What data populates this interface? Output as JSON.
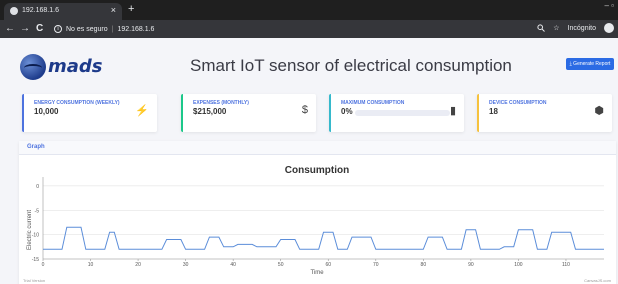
{
  "browser": {
    "tab_title": "192.168.1.6",
    "tab_close": "×",
    "new_tab": "+",
    "window_controls": "–  ▫",
    "nav_back": "←",
    "nav_forward": "→",
    "nav_reload": "C",
    "security_text": "No es seguro",
    "url": "192.168.1.6",
    "zoom_icon": "search-icon",
    "star_icon": "☆",
    "incognito_label": "Incógnito"
  },
  "header": {
    "logo_text": "mads",
    "title": "Smart IoT sensor of electrical consumption",
    "report_button": "⤓ Generate Report"
  },
  "cards": [
    {
      "label": "ENERGY CONSUMPTION (WEEKLY)",
      "value": "10,000",
      "icon": "⚡",
      "color": "#4e73df"
    },
    {
      "label": "EXPENSES (MONTHLY)",
      "value": "$215,000",
      "icon": "$",
      "color": "#1cc88a"
    },
    {
      "label": "MAXIMUM CONSUMPTION",
      "value": "0%",
      "icon": "▮",
      "color": "#36b9cc",
      "progress": 0
    },
    {
      "label": "DEVICE CONSUMPTION",
      "value": "18",
      "icon": "⬢",
      "color": "#f6c23e"
    }
  ],
  "graph": {
    "header": "Graph",
    "footer_left": "Trial Version",
    "footer_right": "CanvasJS.com"
  },
  "chart_data": {
    "type": "line",
    "title": "Consumption",
    "xlabel": "Time",
    "ylabel": "Electric current",
    "xlim": [
      0,
      118
    ],
    "ylim": [
      -15,
      1
    ],
    "x_ticks": [
      0,
      10,
      20,
      30,
      40,
      50,
      60,
      70,
      80,
      90,
      100,
      110
    ],
    "y_ticks": [
      0,
      -5,
      -10,
      -15
    ],
    "grid": true,
    "series": [
      {
        "color": "#5b8dd9",
        "x": [
          0,
          4,
          5,
          8,
          9,
          13,
          14,
          15,
          16,
          19,
          20,
          25,
          26,
          29,
          30,
          34,
          35,
          37,
          38,
          40,
          41,
          44,
          45,
          49,
          50,
          53,
          54,
          58,
          59,
          61,
          62,
          64,
          65,
          69,
          70,
          73,
          74,
          80,
          81,
          84,
          85,
          88,
          89,
          91,
          92,
          96,
          97,
          99,
          100,
          103,
          104,
          106,
          107,
          111,
          112,
          116,
          117,
          118
        ],
        "y": [
          -13,
          -13,
          -8.5,
          -8.5,
          -13,
          -13,
          -9.5,
          -9.5,
          -13,
          -13,
          -13,
          -13,
          -11,
          -11,
          -13,
          -13,
          -10.5,
          -10.5,
          -12.5,
          -12.5,
          -12,
          -12,
          -12.5,
          -12.5,
          -11,
          -11,
          -13,
          -13,
          -9.5,
          -9.5,
          -13,
          -13,
          -10.5,
          -10.5,
          -13,
          -13,
          -13,
          -13,
          -10.5,
          -10.5,
          -13,
          -13,
          -9,
          -9,
          -13,
          -13,
          -12.5,
          -12.5,
          -9,
          -9,
          -13,
          -13,
          -9.5,
          -9.5,
          -13,
          -13,
          -13,
          -13
        ]
      }
    ]
  }
}
